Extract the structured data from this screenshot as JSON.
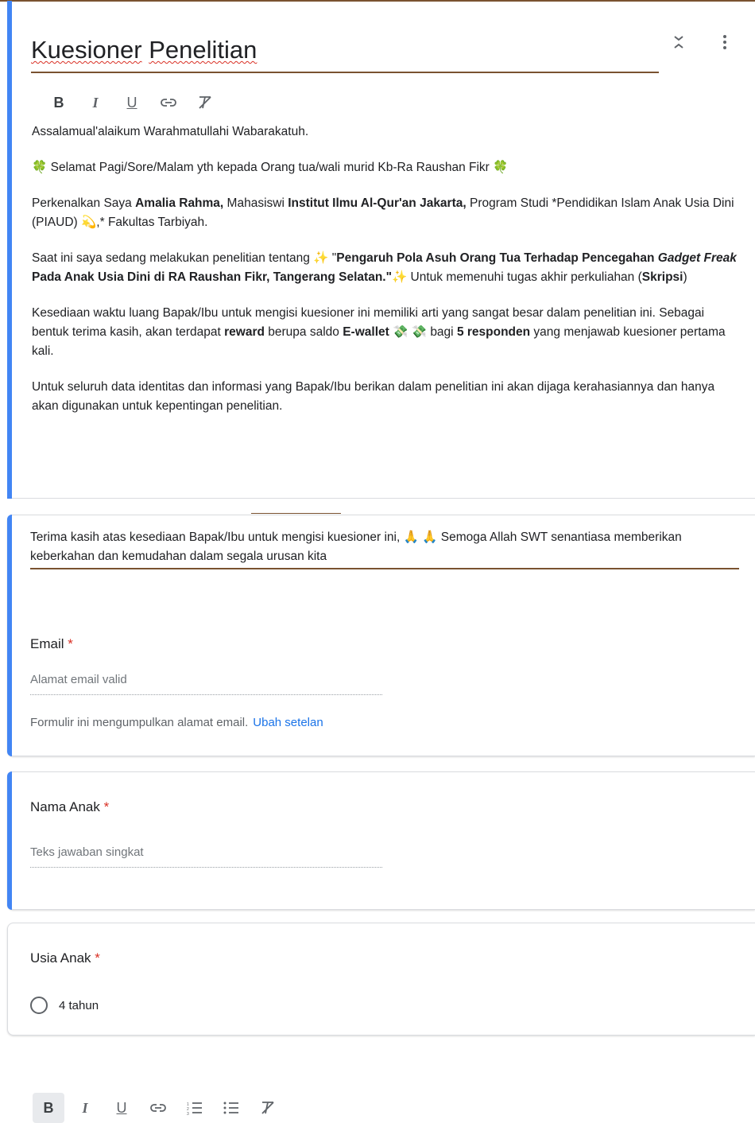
{
  "form": {
    "title_words": [
      "Kuesioner",
      "Penelitian"
    ],
    "description": {
      "p1": "Assalamual'alaikum Warahmatullahi Wabarakatuh.",
      "p2": "🍀 Selamat Pagi/Sore/Malam yth kepada Orang tua/wali murid Kb-Ra Raushan Fikr 🍀",
      "p3_a": "Perkenalkan Saya ",
      "p3_b": "Amalia Rahma,",
      "p3_c": " Mahasiswi ",
      "p3_d": "Institut Ilmu Al-Qur'an Jakarta,",
      "p3_e": " Program Studi *Pendidikan Islam Anak Usia Dini (PIAUD) 💫,* Fakultas Tarbiyah.",
      "p4_a": "Saat ini saya sedang melakukan penelitian tentang  ✨ \"",
      "p4_b": "Pengaruh Pola Asuh Orang Tua Terhadap Pencegahan ",
      "p4_c": "Gadget Freak",
      "p4_d": " Pada Anak Usia Dini di RA Raushan Fikr, Tangerang Selatan.\"",
      "p4_e": "✨ Untuk memenuhi tugas akhir perkuliahan  (",
      "p4_f": "Skripsi",
      "p4_g": ")",
      "p5_a": "Kesediaan waktu luang Bapak/Ibu untuk mengisi kuesioner ini memiliki arti yang sangat besar dalam penelitian ini. Sebagai bentuk terima kasih, akan terdapat ",
      "p5_b": "reward",
      "p5_c": " berupa saldo ",
      "p5_d": "E-wallet",
      "p5_e": " 💸 💸 bagi ",
      "p5_f": "5 responden",
      "p5_g": " yang menjawab kuesioner pertama kali.",
      "p6": "Untuk seluruh data identitas dan informasi yang Bapak/Ibu berikan dalam penelitian ini akan dijaga kerahasiannya dan hanya akan digunakan untuk kepentingan penelitian."
    },
    "thanks_text": "Terima kasih atas kesediaan Bapak/Ibu untuk mengisi kuesioner ini, 🙏 🙏 Semoga Allah SWT senantiasa memberikan keberkahan dan kemudahan dalam segala urusan kita"
  },
  "toolbar": {
    "bold": "B",
    "italic": "I",
    "underline": "U",
    "link_icon": "link-icon",
    "clear_format_icon": "clear-format-icon",
    "numbered_list_icon": "numbered-list-icon",
    "bulleted_list_icon": "bulleted-list-icon"
  },
  "questions": {
    "email": {
      "label": "Email",
      "required_mark": "*",
      "placeholder": "Alamat email valid",
      "note": "Formulir ini mengumpulkan alamat email.",
      "note_link": "Ubah setelan"
    },
    "nama_anak": {
      "label": "Nama Anak",
      "required_mark": "*",
      "placeholder": "Teks jawaban singkat"
    },
    "usia_anak": {
      "label": "Usia Anak",
      "required_mark": "*",
      "options": [
        "4 tahun"
      ]
    }
  },
  "colors": {
    "accent": "#4285f4",
    "required": "#d93025",
    "link": "#1a73e8",
    "underline": "#7a5230"
  }
}
